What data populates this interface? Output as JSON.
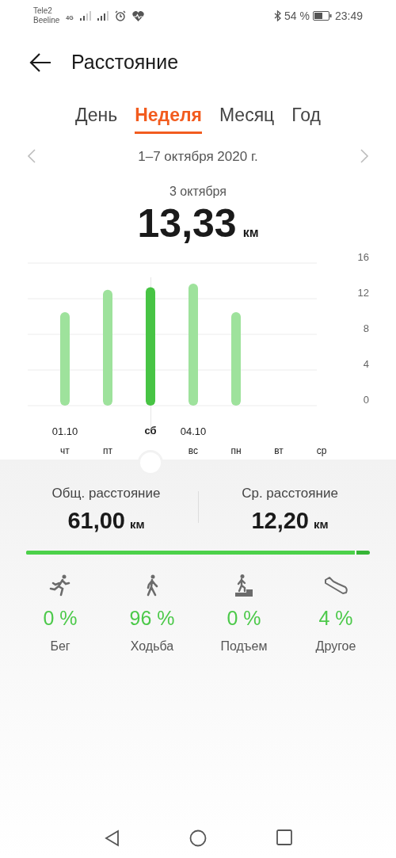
{
  "status_bar": {
    "carrier_1": "Tele2",
    "carrier_2": "Beeline",
    "network": "4G",
    "battery": "54 %",
    "time": "23:49"
  },
  "header": {
    "title": "Расстояние"
  },
  "tabs": [
    {
      "label": "День",
      "selected": false
    },
    {
      "label": "Неделя",
      "selected": true
    },
    {
      "label": "Месяц",
      "selected": false
    },
    {
      "label": "Год",
      "selected": false
    }
  ],
  "period": "1–7 октября 2020 г.",
  "selection": {
    "date": "3 октября",
    "value": "13,33",
    "unit": "км"
  },
  "chart": {
    "chart_data": {
      "type": "bar",
      "categories": [
        "чт",
        "пт",
        "сб",
        "вс",
        "пн",
        "вт",
        "ср"
      ],
      "series": [
        {
          "color": "#9ee29c",
          "values": [
            10.5,
            13.0,
            null,
            13.7,
            10.5,
            null,
            null
          ]
        },
        {
          "color": "#47c444",
          "values": [
            null,
            null,
            13.3,
            null,
            null,
            null,
            null
          ]
        }
      ],
      "ylim": [
        0,
        16
      ],
      "yticks": [
        0,
        4,
        8,
        12,
        16
      ],
      "grid": true
    },
    "day_axis": [
      {
        "date": "01.10",
        "selected": false
      },
      {
        "selected": false
      },
      {
        "selected": true
      },
      {
        "date": "04.10",
        "selected": false
      },
      {
        "selected": false
      },
      {
        "selected": false
      },
      {
        "selected": false
      }
    ]
  },
  "summary": [
    {
      "label": "Общ. расстояние",
      "value": "61,00",
      "unit": "км"
    },
    {
      "label": "Ср. расстояние",
      "value": "12,20",
      "unit": "км"
    }
  ],
  "share_bar": {
    "level": 0.96
  },
  "activities": [
    {
      "kind": "run",
      "percent": "0 %",
      "label": "Бег"
    },
    {
      "kind": "walk",
      "percent": "96 %",
      "label": "Ходьба"
    },
    {
      "kind": "climb",
      "percent": "0 %",
      "label": "Подъем"
    },
    {
      "kind": "other",
      "percent": "4 %",
      "label": "Другое"
    }
  ]
}
